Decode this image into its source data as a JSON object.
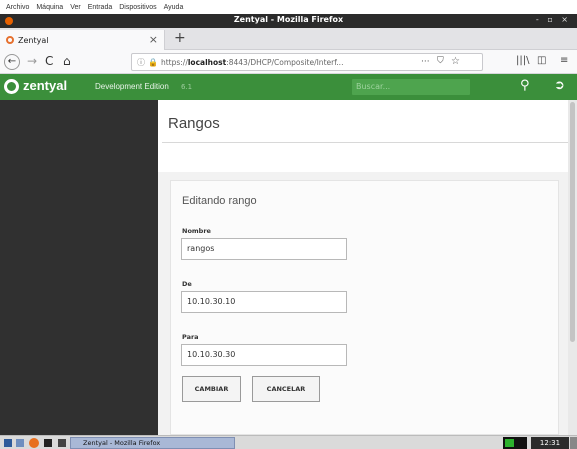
{
  "vm_menu": [
    "Archivo",
    "Máquina",
    "Ver",
    "Entrada",
    "Dispositivos",
    "Ayuda"
  ],
  "window": {
    "title": "Zentyal - Mozilla Firefox",
    "controls": "- ▫ ×"
  },
  "tab": {
    "label": "Zentyal",
    "close": "×",
    "new_tab": "+"
  },
  "nav": {
    "back": "←",
    "forward": "→",
    "reload": "C",
    "home": "⌂",
    "url_prefix": "https://",
    "url_host": "localhost",
    "url_rest": ":8443/DHCP/Composite/Interf...",
    "more": "···",
    "library": "|||\\",
    "sidebar": "◫",
    "menu": "≡"
  },
  "zentyal": {
    "brand": "zentyal",
    "edition": "Development Edition",
    "version": "6.1",
    "search_placeholder": "Buscar..."
  },
  "page": {
    "title": "Rangos",
    "panel_title": "Editando rango",
    "fields": [
      {
        "label": "Nombre",
        "value": "rangos"
      },
      {
        "label": "De",
        "value": "10.10.30.10"
      },
      {
        "label": "Para",
        "value": "10.10.30.30"
      }
    ],
    "buttons": {
      "change": "CAMBIAR",
      "cancel": "CANCELAR"
    }
  },
  "taskbar": {
    "window_label": "Zentyal - Mozilla Firefox",
    "clock": "12:31"
  },
  "colors": {
    "zentyal_green": "#3b8f3b",
    "sidebar_dark": "#303030",
    "firefox_orange": "#e66000"
  }
}
